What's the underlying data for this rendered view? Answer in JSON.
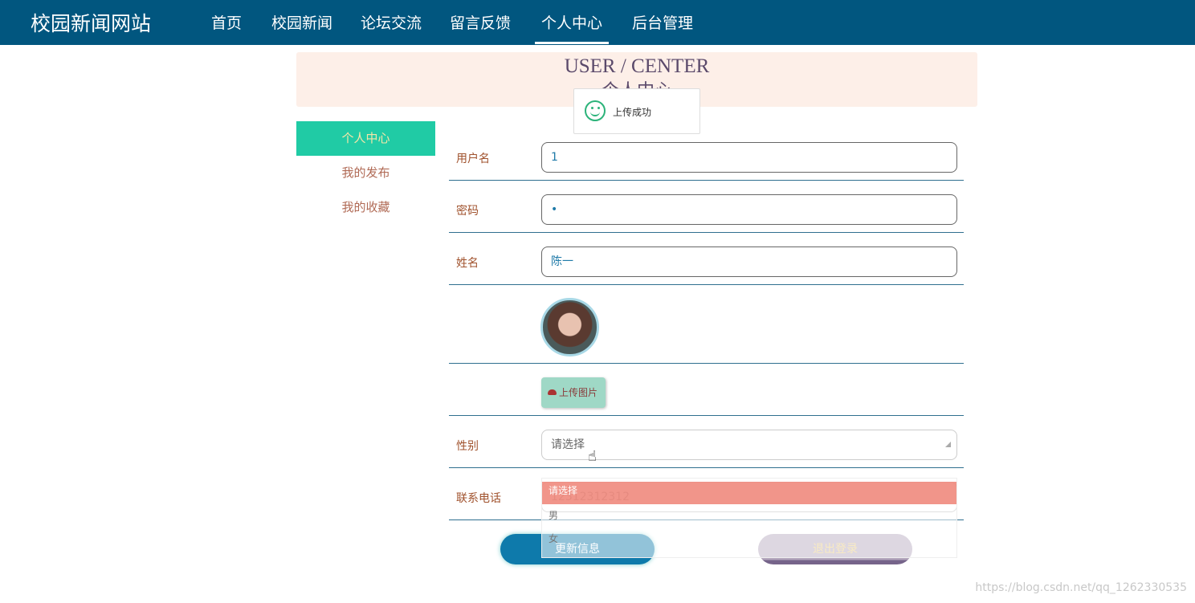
{
  "header": {
    "logo": "校园新闻网站",
    "nav": [
      "首页",
      "校园新闻",
      "论坛交流",
      "留言反馈",
      "个人中心",
      "后台管理"
    ],
    "active": "个人中心",
    "bg": "#01567f"
  },
  "banner": {
    "title": "USER / CENTER",
    "subtitle": "个人中心"
  },
  "toast": {
    "icon": "smile-icon",
    "message": "上传成功"
  },
  "sidebar": {
    "items": [
      "个人中心",
      "我的发布",
      "我的收藏"
    ],
    "active_color": "#20cba5"
  },
  "form": {
    "username": {
      "label": "用户名",
      "value": "1"
    },
    "password": {
      "label": "密码",
      "value": "•"
    },
    "name": {
      "label": "姓名",
      "value": "陈一"
    },
    "upload_label": "上传图片",
    "gender": {
      "label": "性别",
      "placeholder": "请选择",
      "options": [
        "请选择",
        "男",
        "女"
      ]
    },
    "phone": {
      "label": "联系电话",
      "value": "12312312312"
    }
  },
  "buttons": {
    "update": "更新信息",
    "logout": "退出登录"
  },
  "watermark": "https://blog.csdn.net/qq_1262330535"
}
